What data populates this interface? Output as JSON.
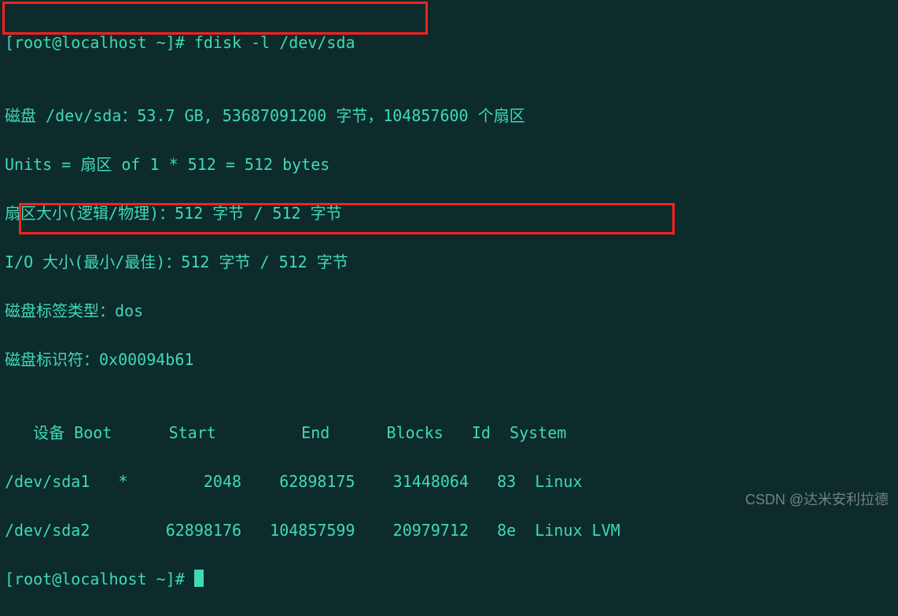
{
  "prompt": {
    "line1_prefix": "[root@localhost ~]# ",
    "command": "fdisk -l /dev/sda",
    "line_last": "[root@localhost ~]# "
  },
  "output": {
    "blank1": "",
    "disk_line": "磁盘 /dev/sda：53.7 GB, 53687091200 字节，104857600 个扇区",
    "units_line": "Units = 扇区 of 1 * 512 = 512 bytes",
    "sector_size": "扇区大小(逻辑/物理)：512 字节 / 512 字节",
    "io_size": "I/O 大小(最小/最佳)：512 字节 / 512 字节",
    "label_type": "磁盘标签类型：dos",
    "disk_id": "磁盘标识符：0x00094b61",
    "blank2": ""
  },
  "table": {
    "header": "   设备 Boot      Start         End      Blocks   Id  System",
    "rows": [
      "/dev/sda1   *        2048    62898175    31448064   83  Linux",
      "/dev/sda2        62898176   104857599    20979712   8e  Linux LVM"
    ]
  },
  "watermark": "CSDN @达米安利拉德"
}
